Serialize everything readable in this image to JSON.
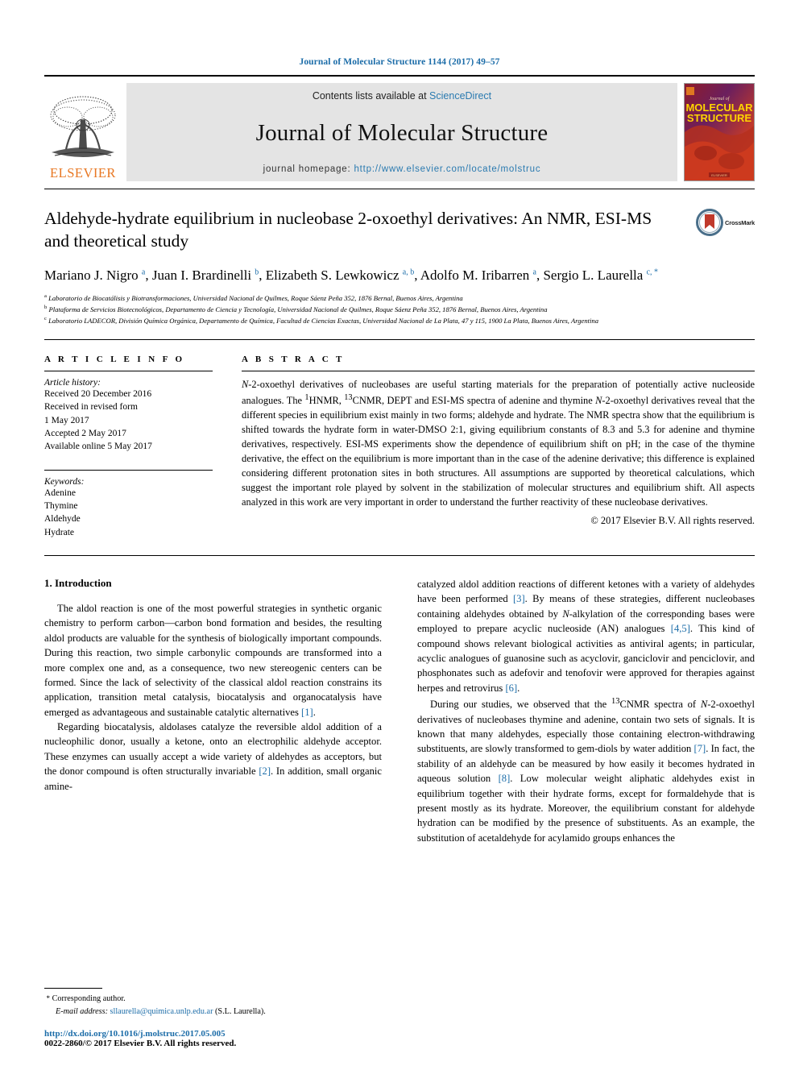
{
  "running_head": "Journal of Molecular Structure 1144 (2017) 49–57",
  "masthead": {
    "contents_prefix": "Contents lists available at ",
    "sciencedirect": "ScienceDirect",
    "journal_name": "Journal of Molecular Structure",
    "homepage_prefix": "journal homepage: ",
    "homepage_url": "http://www.elsevier.com/locate/molstruc",
    "publisher": "ELSEVIER",
    "cover_kicker": "Journal of",
    "cover_line1": "MOLECULAR",
    "cover_line2": "STRUCTURE",
    "cover_footer": "ELSEVIER"
  },
  "article": {
    "title": "Aldehyde-hydrate equilibrium in nucleobase 2-oxoethyl derivatives: An NMR, ESI-MS and theoretical study",
    "crossmark_label": "CrossMark",
    "authors_html": "Mariano J. Nigro <sup>a</sup>, Juan I. Brardinelli <sup>b</sup>, Elizabeth S. Lewkowicz <sup>a, b</sup>, Adolfo M. Iribarren <sup>a</sup>, Sergio L. Laurella <sup>c, *</sup>",
    "affiliations": [
      {
        "marker": "a",
        "text": "Laboratorio de Biocatálisis y Biotransformaciones, Universidad Nacional de Quilmes, Roque Sáenz Peña 352, 1876 Bernal, Buenos Aires, Argentina"
      },
      {
        "marker": "b",
        "text": "Plataforma de Servicios Biotecnológicos, Departamento de Ciencia y Tecnología, Universidad Nacional de Quilmes, Roque Sáenz Peña 352, 1876 Bernal, Buenos Aires, Argentina"
      },
      {
        "marker": "c",
        "text": "Laboratorio LADECOR, División Química Orgánica, Departamento de Química, Facultad de Ciencias Exactas, Universidad Nacional de La Plata, 47 y 115, 1900 La Plata, Buenos Aires, Argentina"
      }
    ]
  },
  "article_info": {
    "label": "A R T I C L E   I N F O",
    "history_title": "Article history:",
    "history": [
      "Received 20 December 2016",
      "Received in revised form",
      "1 May 2017",
      "Accepted 2 May 2017",
      "Available online 5 May 2017"
    ],
    "keywords_title": "Keywords:",
    "keywords": [
      "Adenine",
      "Thymine",
      "Aldehyde",
      "Hydrate"
    ]
  },
  "abstract": {
    "label": "A B S T R A C T",
    "text_html": "<i>N</i>-2-oxoethyl derivatives of nucleobases are useful starting materials for the preparation of potentially active nucleoside analogues. The <sup>1</sup>HNMR, <sup>13</sup>CNMR, DEPT and ESI-MS spectra of adenine and thymine <i>N</i>-2-oxoethyl derivatives reveal that the different species in equilibrium exist mainly in two forms; aldehyde and hydrate. The NMR spectra show that the equilibrium is shifted towards the hydrate form in water-DMSO 2:1, giving equilibrium constants of 8.3 and 5.3 for adenine and thymine derivatives, respectively. ESI-MS experiments show the dependence of equilibrium shift on pH; in the case of the thymine derivative, the effect on the equilibrium is more important than in the case of the adenine derivative; this difference is explained considering different protonation sites in both structures. All assumptions are supported by theoretical calculations, which suggest the important role played by solvent in the stabilization of molecular structures and equilibrium shift. All aspects analyzed in this work are very important in order to understand the further reactivity of these nucleobase derivatives.",
    "copyright": "© 2017 Elsevier B.V. All rights reserved."
  },
  "body": {
    "section_heading": "1. Introduction",
    "left_paragraphs_html": [
      "The aldol reaction is one of the most powerful strategies in synthetic organic chemistry to perform carbon—carbon bond formation and besides, the resulting aldol products are valuable for the synthesis of biologically important compounds. During this reaction, two simple carbonylic compounds are transformed into a more complex one and, as a consequence, two new stereogenic centers can be formed. Since the lack of selectivity of the classical aldol reaction constrains its application, transition metal catalysis, biocatalysis and organocatalysis have emerged as advantageous and sustainable catalytic alternatives <span class=\"ref\">[1]</span>.",
      "Regarding biocatalysis, aldolases catalyze the reversible aldol addition of a nucleophilic donor, usually a ketone, onto an electrophilic aldehyde acceptor. These enzymes can usually accept a wide variety of aldehydes as acceptors, but the donor compound is often structurally invariable <span class=\"ref\">[2]</span>. In addition, small organic amine-"
    ],
    "right_paragraphs_html": [
      "catalyzed aldol addition reactions of different ketones with a variety of aldehydes have been performed <span class=\"ref\">[3]</span>. By means of these strategies, different nucleobases containing aldehydes obtained by <i>N</i>-alkylation of the corresponding bases were employed to prepare acyclic nucleoside (AN) analogues <span class=\"ref\">[4,5]</span>. This kind of compound shows relevant biological activities as antiviral agents; in particular, acyclic analogues of guanosine such as acyclovir, ganciclovir and penciclovir, and phosphonates such as adefovir and tenofovir were approved for therapies against herpes and retrovirus <span class=\"ref\">[6]</span>.",
      "During our studies, we observed that the <sup>13</sup>CNMR spectra of <i>N</i>-2-oxoethyl derivatives of nucleobases thymine and adenine, contain two sets of signals. It is known that many aldehydes, especially those containing electron-withdrawing substituents, are slowly transformed to gem-diols by water addition <span class=\"ref\">[7]</span>. In fact, the stability of an aldehyde can be measured by how easily it becomes hydrated in aqueous solution <span class=\"ref\">[8]</span>. Low molecular weight aliphatic aldehydes exist in equilibrium together with their hydrate forms, except for formaldehyde that is present mostly as its hydrate. Moreover, the equilibrium constant for aldehyde hydration can be modified by the presence of substituents. As an example, the substitution of acetaldehyde for acylamido groups enhances the"
    ]
  },
  "footer": {
    "corresponding_star": "*",
    "corresponding_label": "Corresponding author.",
    "email_label": "E-mail address:",
    "email": "sllaurella@quimica.unlp.edu.ar",
    "email_owner": "(S.L. Laurella).",
    "doi": "http://dx.doi.org/10.1016/j.molstruc.2017.05.005",
    "issn_line": "0022-2860/© 2017 Elsevier B.V. All rights reserved."
  },
  "colors": {
    "link_blue": "#1b6ca8",
    "sciencedirect_blue": "#2a7ab0",
    "elsevier_orange": "#e87722",
    "band_grey": "#e4e4e4"
  }
}
